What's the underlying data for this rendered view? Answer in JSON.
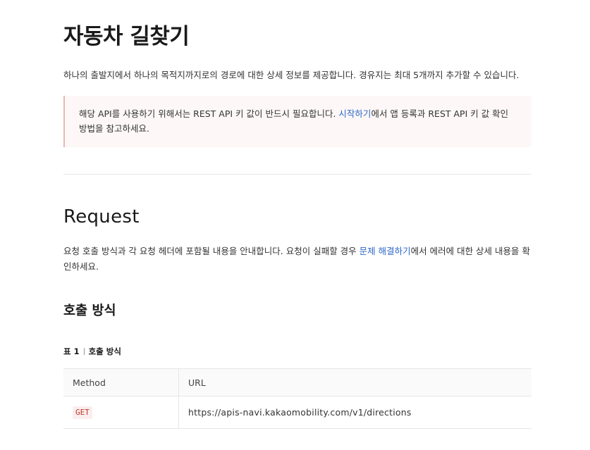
{
  "page": {
    "title": "자동차 길찾기",
    "intro": "하나의 출발지에서 하나의 목적지까지로의 경로에 대한 상세 정보를 제공합니다. 경유지는 최대 5개까지 추가할 수 있습니다."
  },
  "notice": {
    "text_before": "해당 API를 사용하기 위해서는 REST API 키 값이 반드시 필요합니다. ",
    "link": "시작하기",
    "text_after": "에서 앱 등록과 REST API 키 값 확인 방법을 참고하세요."
  },
  "request": {
    "title": "Request",
    "desc_before": "요청 호출 방식과 각 요청 헤더에 포함될 내용을 안내합니다. 요청이 실패할 경우 ",
    "desc_link": "문제 해결하기",
    "desc_after": "에서 에러에 대한 상세 내용을 확인하세요."
  },
  "call_method": {
    "title": "호출 방식",
    "caption_label": "표 1",
    "caption_text": "호출 방식",
    "headers": [
      "Method",
      "URL"
    ],
    "rows": [
      {
        "method": "GET",
        "url": "https://apis-navi.kakaomobility.com/v1/directions"
      }
    ]
  }
}
